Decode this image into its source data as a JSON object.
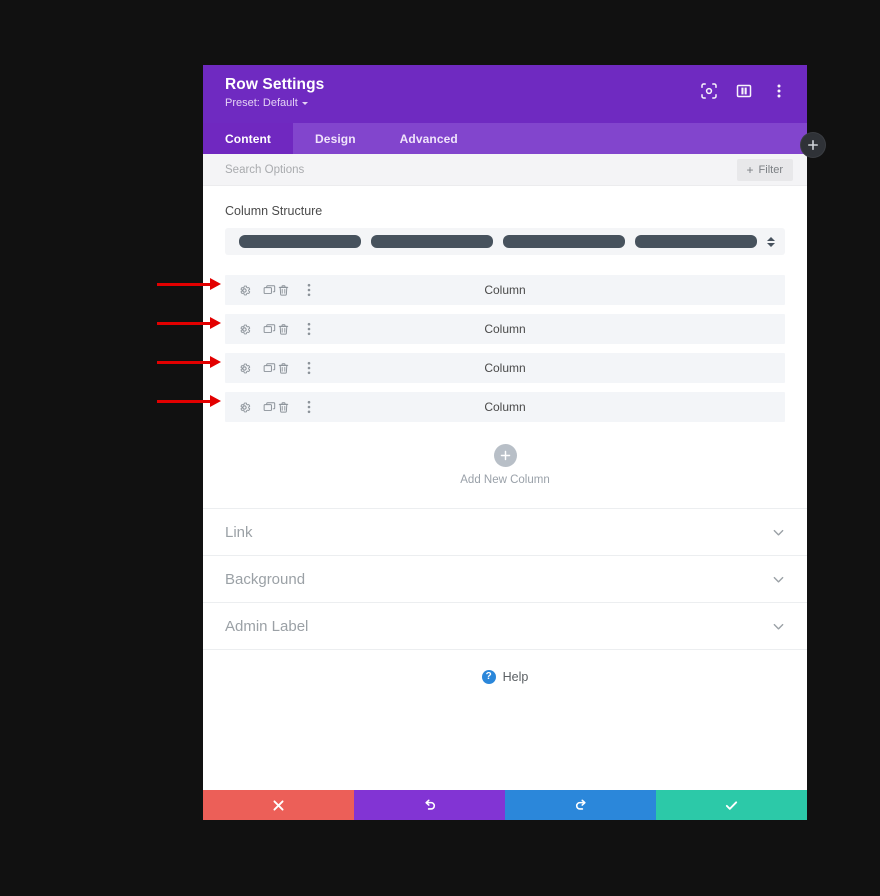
{
  "header": {
    "title": "Row Settings",
    "preset_label": "Preset: Default",
    "icons": {
      "focus": "focus-target-icon",
      "layout": "layout-panel-icon",
      "more": "more-vertical-icon"
    }
  },
  "tabs": [
    {
      "label": "Content",
      "active": true
    },
    {
      "label": "Design",
      "active": false
    },
    {
      "label": "Advanced",
      "active": false
    }
  ],
  "search": {
    "placeholder": "Search Options",
    "value": "",
    "filter_label": "Filter",
    "filter_plus": "+"
  },
  "column_structure": {
    "label": "Column Structure",
    "bars": 4
  },
  "columns": [
    {
      "name": "Column"
    },
    {
      "name": "Column"
    },
    {
      "name": "Column"
    },
    {
      "name": "Column"
    }
  ],
  "add_column": {
    "label": "Add New Column",
    "icon": "plus-icon"
  },
  "toggle_sections": [
    {
      "title": "Link"
    },
    {
      "title": "Background"
    },
    {
      "title": "Admin Label"
    }
  ],
  "help": {
    "label": "Help",
    "badge": "?"
  },
  "footer_buttons": [
    {
      "name": "cancel",
      "icon": "close-x-icon",
      "color": "#ec5f58"
    },
    {
      "name": "undo",
      "icon": "undo-arrow-icon",
      "color": "#8234d4"
    },
    {
      "name": "redo",
      "icon": "redo-arrow-icon",
      "color": "#2b87da"
    },
    {
      "name": "save",
      "icon": "check-icon",
      "color": "#2cc9a8"
    }
  ],
  "floating_add": {
    "icon": "plus-icon"
  },
  "annotations": {
    "arrow_count": 4,
    "arrow_color": "#e30000"
  },
  "colors": {
    "header_purple": "#6f2ac1",
    "tabbar_purple": "#8245cd",
    "active_tab_purple": "#7028c0",
    "page_background": "#111111",
    "modal_background": "#ffffff",
    "row_background": "#f3f5f8",
    "struct_bar": "#47525d"
  }
}
